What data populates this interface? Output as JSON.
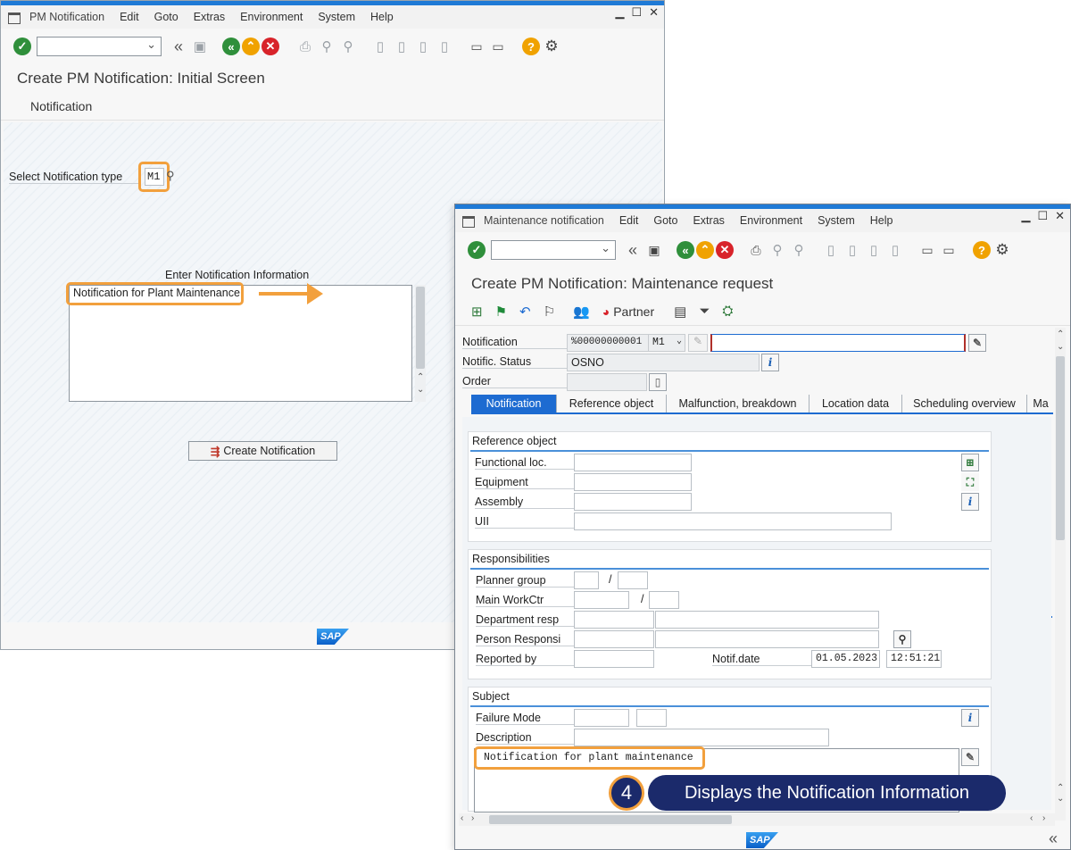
{
  "win1": {
    "menu": {
      "app": "PM Notification",
      "items": [
        "Edit",
        "Goto",
        "Extras",
        "Environment",
        "System",
        "Help"
      ]
    },
    "title": "Create PM Notification: Initial Screen",
    "subbar": "Notification",
    "select_type_label": "Select Notification type",
    "notif_type_value": "M1",
    "enter_info_label": "Enter Notification Information",
    "info_text": "Notification for Plant Maintenance",
    "create_button": "Create Notification",
    "sap_logo": "SAP"
  },
  "win2": {
    "menu": {
      "app": "Maintenance notification",
      "items": [
        "Edit",
        "Goto",
        "Extras",
        "Environment",
        "System",
        "Help"
      ]
    },
    "title": "Create PM Notification: Maintenance request",
    "partner_label": "Partner",
    "header": {
      "notification_label": "Notification",
      "notification_value": "%00000000001",
      "notif_type": "M1",
      "status_label": "Notific. Status",
      "status_value": "OSNO",
      "order_label": "Order"
    },
    "tabs": [
      "Notification",
      "Reference object",
      "Malfunction, breakdown",
      "Location data",
      "Scheduling overview",
      "Ma"
    ],
    "ref_object": {
      "heading": "Reference object",
      "functional_loc": "Functional loc.",
      "equipment": "Equipment",
      "assembly": "Assembly",
      "uii": "UII"
    },
    "responsibilities": {
      "heading": "Responsibilities",
      "planner_group": "Planner group",
      "main_workctr": "Main WorkCtr",
      "department_resp": "Department resp",
      "person_resp": "Person Responsi",
      "reported_by": "Reported by",
      "notif_date_label": "Notif.date",
      "notif_date": "01.05.2023",
      "notif_time": "12:51:21",
      "slash": "/"
    },
    "subject": {
      "heading": "Subject",
      "failure_mode": "Failure Mode",
      "description": "Description",
      "long_text": "Notification for plant maintenance"
    },
    "sap_logo": "SAP"
  },
  "callout": {
    "step": "4",
    "text": "Displays the Notification Information"
  },
  "colors": {
    "accent": "#f2a03d",
    "sap_blue": "#1d6bd1",
    "callout_bg": "#1b2a6b"
  }
}
